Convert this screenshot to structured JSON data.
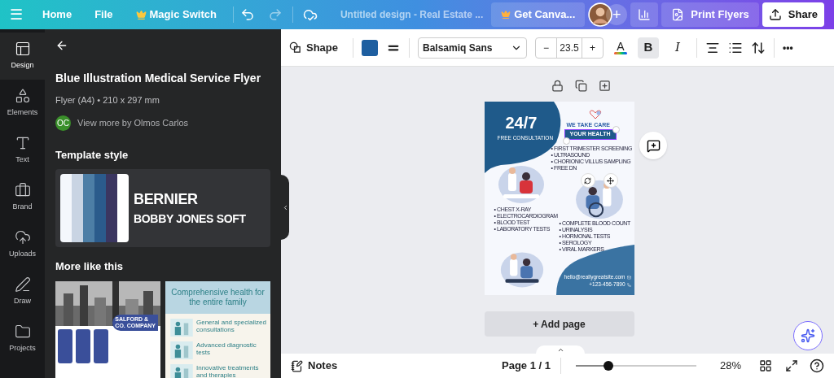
{
  "top_bar": {
    "menu": "☰",
    "items": [
      {
        "label": "Home"
      },
      {
        "label": "File"
      },
      {
        "label": "Magic Switch",
        "kind": "crown"
      }
    ],
    "title": "Untitled design - Real Estate ...",
    "upgrade": "Get Canva...",
    "add": "+",
    "print": "Print Flyers",
    "share": "Share"
  },
  "rail": [
    {
      "label": "Design",
      "selected": true
    },
    {
      "label": "Elements",
      "selected": false
    },
    {
      "label": "Text",
      "selected": false
    },
    {
      "label": "Brand",
      "selected": false
    },
    {
      "label": "Uploads",
      "selected": false
    },
    {
      "label": "Draw",
      "selected": false
    },
    {
      "label": "Projects",
      "selected": false
    }
  ],
  "panel": {
    "title": "Blue Illustration Medical Service Flyer",
    "meta": "Flyer (A4) • 210 x 297 mm",
    "author_initials": "OC",
    "author_link": "View more by Olmos Carlos",
    "style_heading": "Template style",
    "palette": [
      {
        "color": "#f4f7fc"
      },
      {
        "color": "#c9d4e3"
      },
      {
        "color": "#4d7ea6"
      },
      {
        "color": "#2b5b8c"
      },
      {
        "color": "#3b3660"
      },
      {
        "color": "#ffffff"
      }
    ],
    "fonts": [
      "BERNIER",
      "BOBBY JONES SOFT"
    ],
    "more_heading": "More like this",
    "thumbs": [
      {
        "kind": "company",
        "texts": [
          "SALFORD &",
          "CO. COMPANY"
        ]
      },
      {
        "kind": "health",
        "title": "Comprehensive health for the entire family",
        "items": [
          "General and specialized consultations",
          "Advanced diagnostic tests",
          "Innovative treatments and therapies"
        ]
      }
    ]
  },
  "toolbar": {
    "shape": "Shape",
    "font": "Balsamiq Sans",
    "minus": "−",
    "size": "23.5",
    "plus": "+",
    "text_color": "A",
    "bold": {
      "label": "B",
      "selected": true
    },
    "italic": {
      "label": "I",
      "selected": false
    },
    "more": "•••"
  },
  "flyer": {
    "headline": "24/7",
    "subhead": "FREE CONSULTATION",
    "tagline": "WE TAKE CARE",
    "selected_text": "YOUR HEALTH",
    "list_1": [
      "• FIRST TRIMESTER SCREENING",
      "• ULTRASOUND",
      "• CHORIONIC VILLUS SAMPLING",
      "• FREE DN"
    ],
    "list_2": [
      "• CHEST X-RAY",
      "• ELECTROCARDIOGRAM",
      "• BLOOD TEST",
      "• LABORATORY TESTS"
    ],
    "list_3": [
      "• COMPLETE BLOOD COUNT",
      "• URINALYSIS",
      "• HORMONAL TESTS",
      "• SEROLOGY",
      "• VIRAL MARKERS"
    ],
    "email": "hello@reallygreatsite.com",
    "phone": "+123-456-7890"
  },
  "add_page": "+ Add page",
  "bottom_bar": {
    "notes": "Notes",
    "page": "Page 1 / 1",
    "zoom": {
      "level": 0.27
    },
    "zoom_reading": "28%"
  }
}
